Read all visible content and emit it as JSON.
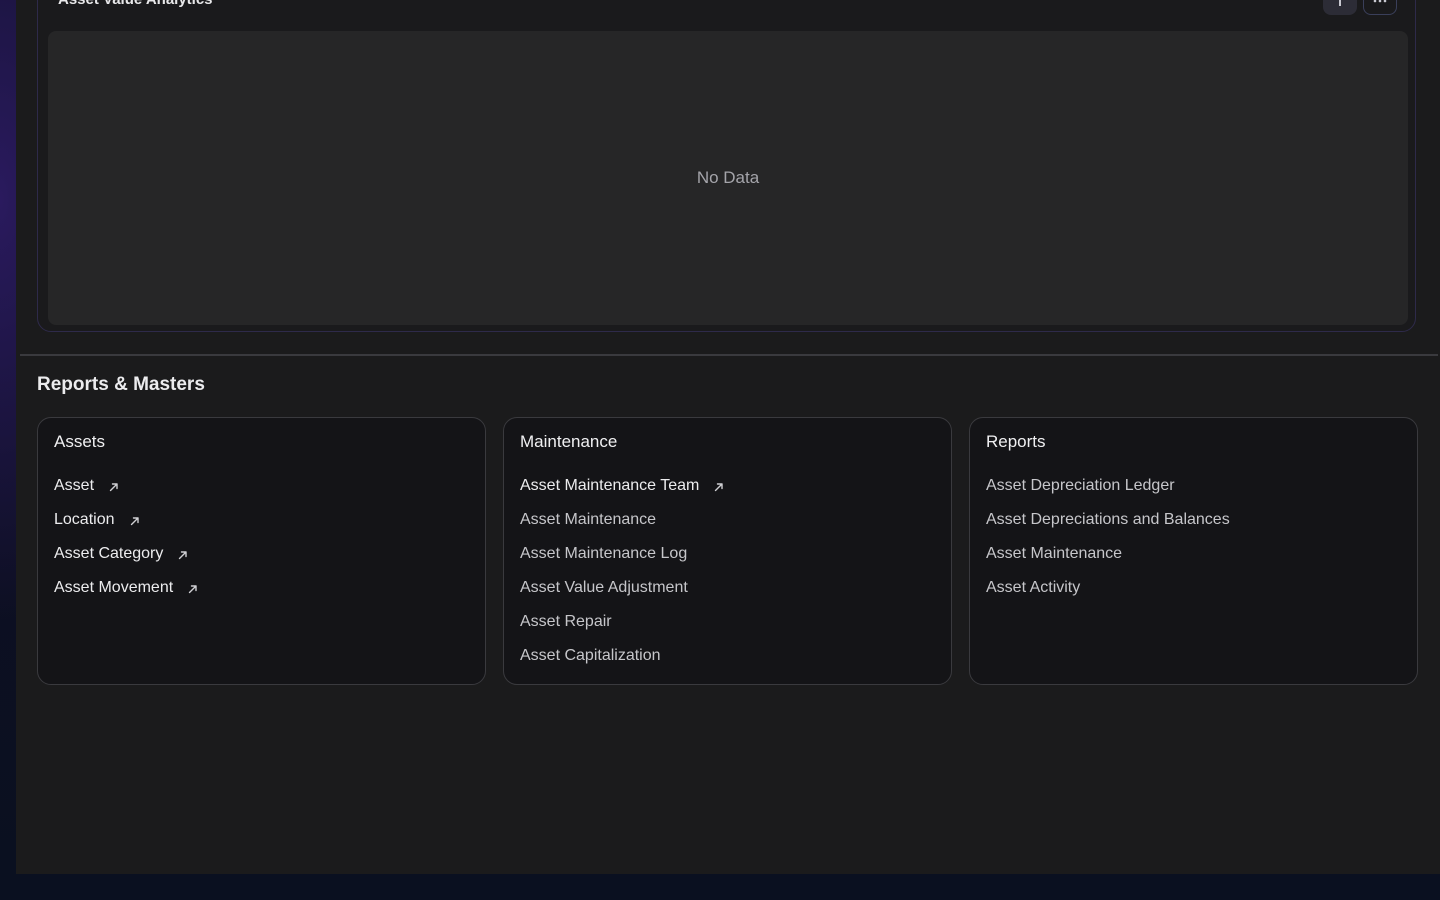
{
  "chart_card": {
    "title": "Asset Value Analytics",
    "empty_message": "No Data",
    "action_primary_icon": "info-icon",
    "action_secondary_icon": "more-icon"
  },
  "section": {
    "title": "Reports & Masters"
  },
  "cards": [
    {
      "title": "Assets",
      "items": [
        {
          "label": "Asset",
          "linked": true
        },
        {
          "label": "Location",
          "linked": true
        },
        {
          "label": "Asset Category",
          "linked": true
        },
        {
          "label": "Asset Movement",
          "linked": true
        }
      ]
    },
    {
      "title": "Maintenance",
      "items": [
        {
          "label": "Asset Maintenance Team",
          "linked": true
        },
        {
          "label": "Asset Maintenance",
          "linked": false
        },
        {
          "label": "Asset Maintenance Log",
          "linked": false
        },
        {
          "label": "Asset Value Adjustment",
          "linked": false
        },
        {
          "label": "Asset Repair",
          "linked": false
        },
        {
          "label": "Asset Capitalization",
          "linked": false
        }
      ]
    },
    {
      "title": "Reports",
      "items": [
        {
          "label": "Asset Depreciation Ledger",
          "linked": false
        },
        {
          "label": "Asset Depreciations and Balances",
          "linked": false
        },
        {
          "label": "Asset Maintenance",
          "linked": false
        },
        {
          "label": "Asset Activity",
          "linked": false
        }
      ]
    }
  ]
}
